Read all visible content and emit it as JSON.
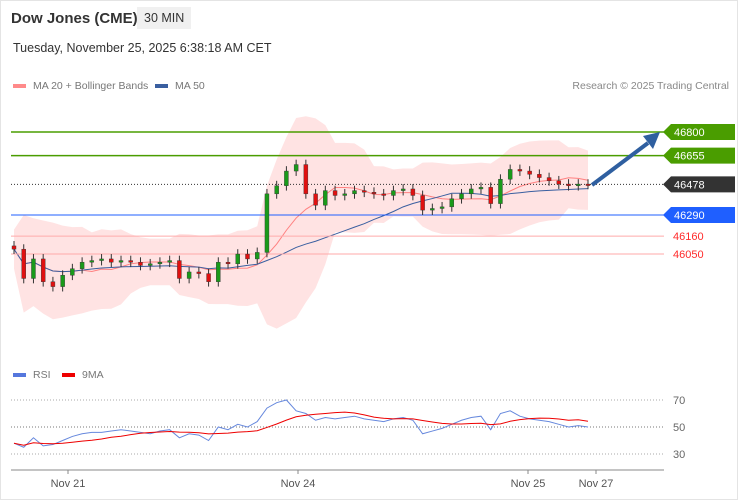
{
  "header": {
    "title": "Dow Jones (CME)",
    "timeframe": "30 MIN",
    "datetime": "Tuesday, November 25, 2025 6:38:18 AM CET",
    "credit": "Research © 2025 Trading Central"
  },
  "legend": {
    "ma20": "MA 20 + Bollinger Bands",
    "ma50": "MA 50",
    "rsi": "RSI",
    "ma9": "9MA"
  },
  "colors": {
    "green": "#4a9d00",
    "blue": "#1f5fff",
    "dark": "#333333",
    "red": "#ff2a2a",
    "ma50": "#3a5fa0",
    "band": "#ffe3e3"
  },
  "chart_data": {
    "type": "candlestick",
    "levels": [
      {
        "value": 46800,
        "kind": "resistance",
        "label": "46800"
      },
      {
        "value": 46655,
        "kind": "resistance",
        "label": "46655"
      },
      {
        "value": 46478,
        "kind": "current",
        "label": "46478"
      },
      {
        "value": 46290,
        "kind": "pivot",
        "label": "46290"
      },
      {
        "value": 46160,
        "kind": "support",
        "label": "46160"
      },
      {
        "value": 46050,
        "kind": "support",
        "label": "46050"
      }
    ],
    "closes": [
      46080,
      45900,
      46020,
      45880,
      45850,
      45920,
      45960,
      46000,
      46010,
      46020,
      46000,
      46010,
      46000,
      45980,
      45990,
      46000,
      46010,
      45900,
      45940,
      45930,
      45880,
      46000,
      45990,
      46050,
      46020,
      46060,
      46420,
      46470,
      46560,
      46600,
      46420,
      46350,
      46440,
      46410,
      46420,
      46440,
      46430,
      46420,
      46410,
      46440,
      46450,
      46410,
      46320,
      46330,
      46340,
      46390,
      46420,
      46450,
      46460,
      46360,
      46510,
      46570,
      46560,
      46540,
      46520,
      46500,
      46480,
      46470,
      46480,
      46478
    ],
    "rsi": [
      38,
      35,
      42,
      36,
      37,
      40,
      43,
      45,
      46,
      46,
      47,
      48,
      47,
      46,
      45,
      47,
      48,
      42,
      45,
      44,
      40,
      50,
      48,
      52,
      50,
      54,
      64,
      68,
      70,
      62,
      60,
      55,
      57,
      56,
      57,
      58,
      56,
      55,
      54,
      56,
      57,
      55,
      45,
      47,
      49,
      52,
      55,
      57,
      58,
      48,
      60,
      62,
      58,
      56,
      55,
      54,
      52,
      50,
      51,
      50
    ],
    "rsi_axis": [
      70,
      50,
      30
    ],
    "x_labels": [
      "Nov 21",
      "Nov 24",
      "Nov 25",
      "Nov 27"
    ]
  }
}
